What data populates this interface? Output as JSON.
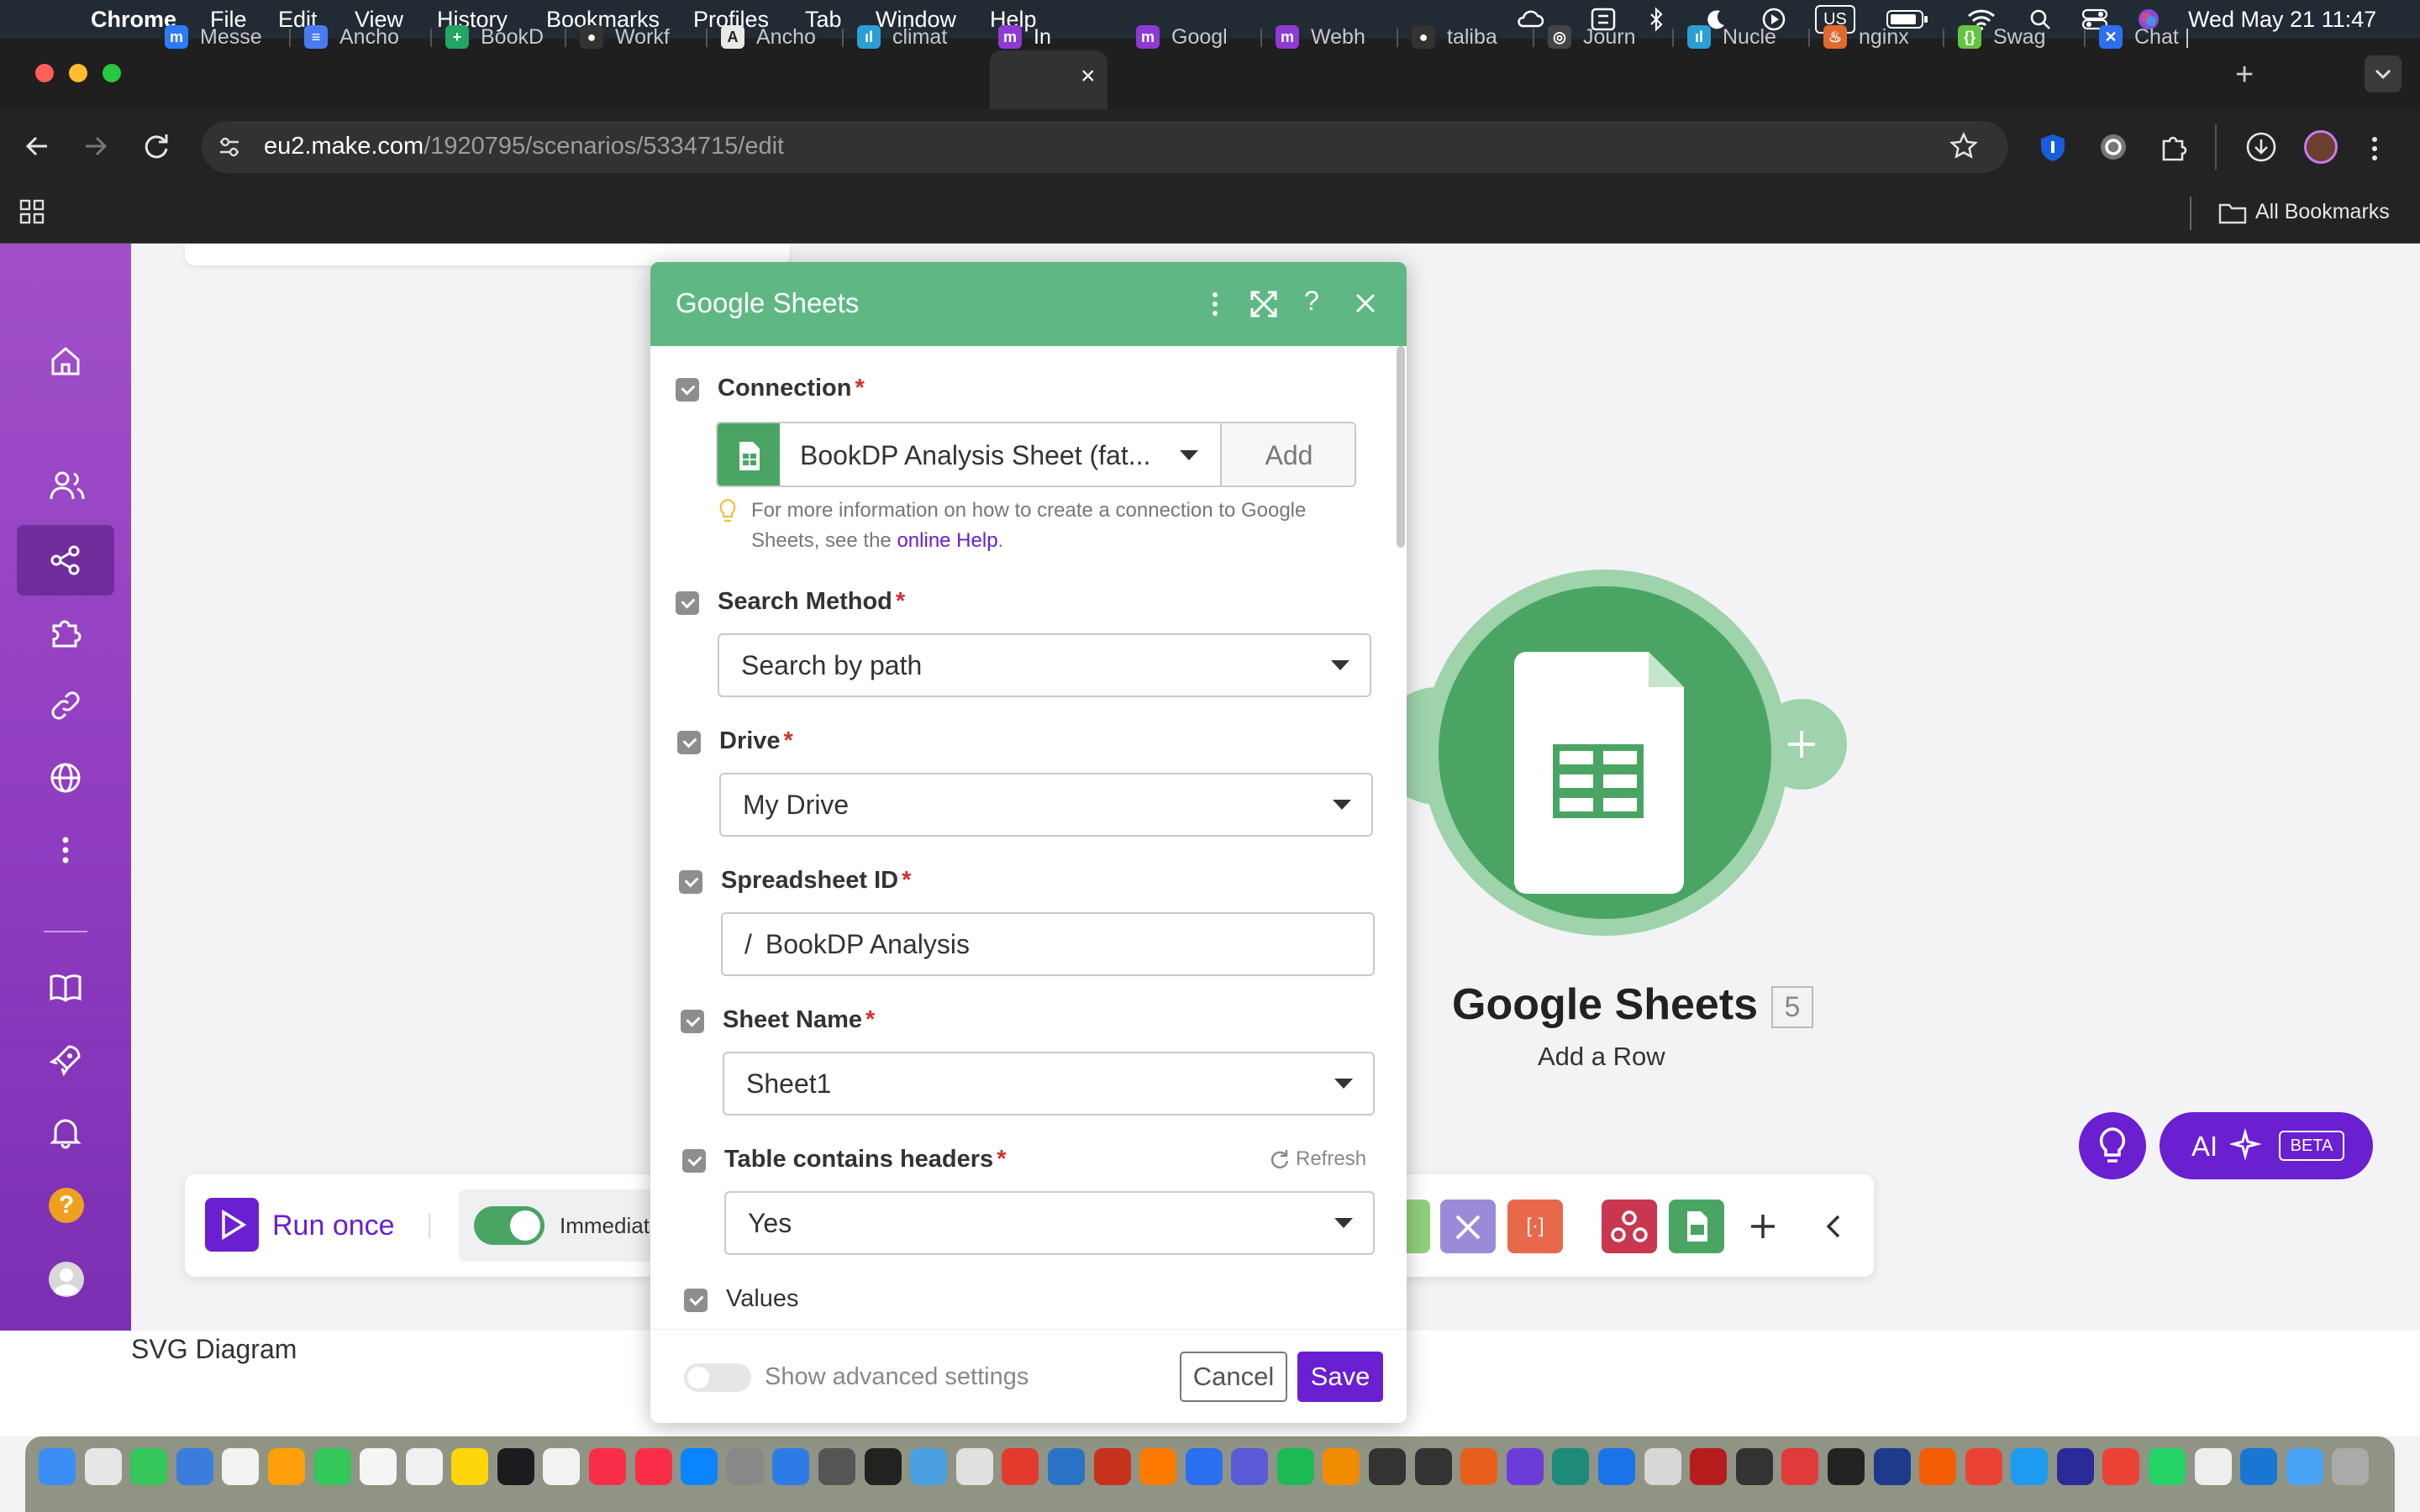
{
  "menubar": {
    "app": "Chrome",
    "items": [
      "File",
      "Edit",
      "View",
      "History",
      "Bookmarks",
      "Profiles",
      "Tab",
      "Window",
      "Help"
    ],
    "clock": "Wed May 21  11:47",
    "input_source": "US"
  },
  "tabs": [
    {
      "label": "Messe",
      "color": "#2d7cf6",
      "glyph": "m"
    },
    {
      "label": "Ancho",
      "color": "#4a7af0",
      "glyph": "≡"
    },
    {
      "label": "BookD",
      "color": "#23a566",
      "glyph": "+"
    },
    {
      "label": "Workf",
      "color": "#333333",
      "glyph": "●"
    },
    {
      "label": "Ancho",
      "color": "#e9e9e9",
      "glyph": "A"
    },
    {
      "label": "climat",
      "color": "#2a9fd6",
      "glyph": "ıl"
    },
    {
      "label": "In",
      "color": "#8d3bd4",
      "glyph": "m",
      "active": true
    },
    {
      "label": "Googl",
      "color": "#8d3bd4",
      "glyph": "m"
    },
    {
      "label": "Webh",
      "color": "#8d3bd4",
      "glyph": "m"
    },
    {
      "label": "taliba",
      "color": "#333333",
      "glyph": "●"
    },
    {
      "label": "Journ",
      "color": "#444444",
      "glyph": "◎"
    },
    {
      "label": "Nucle",
      "color": "#2a9fd6",
      "glyph": "ıl"
    },
    {
      "label": "nginx",
      "color": "#e16a2e",
      "glyph": "♨"
    },
    {
      "label": "Swag",
      "color": "#65c343",
      "glyph": "{}"
    },
    {
      "label": "Chat |",
      "color": "#2d6ff0",
      "glyph": "✕"
    }
  ],
  "address": {
    "host": "eu2.make.com",
    "path": "/1920795/scenarios/5334715/edit"
  },
  "bookmarks": {
    "all_label": "All Bookmarks"
  },
  "sidebar": {
    "items": [
      "home-icon",
      "team-icon",
      "scenarios-icon",
      "apps-icon",
      "connections-icon",
      "webhooks-icon",
      "more-icon",
      "docs-icon",
      "whats-new-icon",
      "notifications-icon",
      "help-icon",
      "profile-icon"
    ]
  },
  "modal": {
    "title": "Google Sheets",
    "connection": {
      "label": "Connection",
      "value": "BookDP Analysis Sheet (fat...",
      "add": "Add",
      "help_prefix": "For more information on how to create a connection to Google Sheets, see the ",
      "help_link": "online Help",
      "help_suffix": "."
    },
    "search_method": {
      "label": "Search Method",
      "value": "Search by path"
    },
    "drive": {
      "label": "Drive",
      "value": "My Drive"
    },
    "spreadsheet_id": {
      "label": "Spreadsheet ID",
      "value": "BookDP Analysis",
      "prefix": "/"
    },
    "sheet_name": {
      "label": "Sheet Name",
      "value": "Sheet1"
    },
    "headers": {
      "label": "Table contains headers",
      "value": "Yes",
      "refresh": "Refresh"
    },
    "values": {
      "label": "Values"
    },
    "advanced": {
      "label": "Show advanced settings",
      "enabled": false
    },
    "cancel": "Cancel",
    "save": "Save"
  },
  "module": {
    "name": "Google Sheets",
    "badge": "5",
    "action": "Add a Row",
    "color": "#4aa564"
  },
  "bottombar": {
    "run_once": "Run once",
    "schedule": "Immediate",
    "schedule_on": true
  },
  "ai_button": {
    "label": "AI",
    "beta": "BETA"
  },
  "diagram_label": "SVG Diagram",
  "colors": {
    "accent": "#6a1fd0",
    "sheets_green": "#4aa564",
    "sidebar": "#8f3cc0"
  }
}
